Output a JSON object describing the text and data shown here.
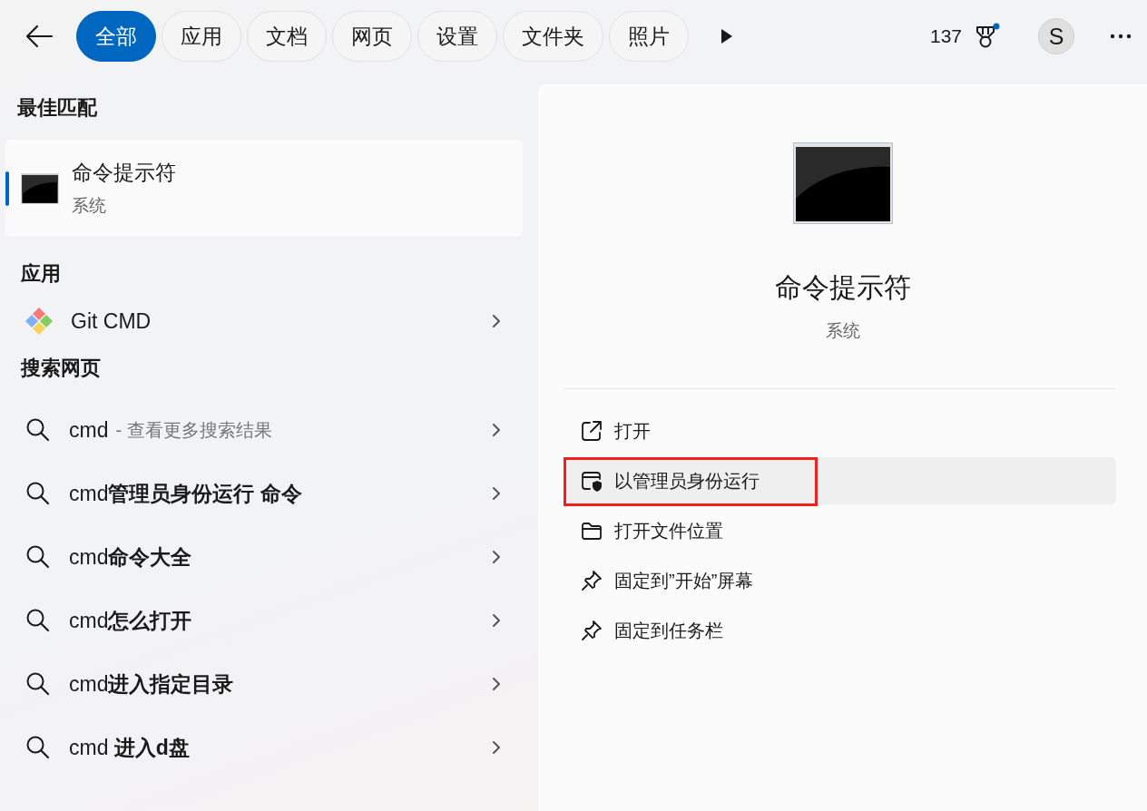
{
  "filter_tabs": [
    {
      "label": "全部",
      "selected": true
    },
    {
      "label": "应用",
      "selected": false
    },
    {
      "label": "文档",
      "selected": false
    },
    {
      "label": "网页",
      "selected": false
    },
    {
      "label": "设置",
      "selected": false
    },
    {
      "label": "文件夹",
      "selected": false
    },
    {
      "label": "照片",
      "selected": false
    }
  ],
  "points": "137",
  "rewards": {
    "unread": true
  },
  "avatar": {
    "initial": "S"
  },
  "best_match": {
    "title": "最佳匹配",
    "item": {
      "name": "命令提示符",
      "type": "系统",
      "selected": true
    }
  },
  "apps": {
    "title": "应用",
    "items": [
      {
        "name": "Git CMD"
      }
    ]
  },
  "web_search": {
    "title": "搜索网页",
    "items": [
      {
        "query": "cmd",
        "hint": "- 查看更多搜索结果"
      },
      {
        "query": "cmd**管理员身份运行 命令**"
      },
      {
        "query": "cmd**命令大全**"
      },
      {
        "query": "cmd**怎么打开**"
      },
      {
        "query": "cmd**进入指定目录**"
      },
      {
        "query": "cmd **进入d盘**"
      }
    ]
  },
  "details": {
    "name": "命令提示符",
    "type": "系统",
    "actions": [
      {
        "kind": "open",
        "label": "打开",
        "hovered": false,
        "highlighted": false
      },
      {
        "kind": "admin",
        "label": "以管理员身份运行",
        "hovered": true,
        "highlighted": true
      },
      {
        "kind": "folder",
        "label": "打开文件位置",
        "hovered": false,
        "highlighted": false
      },
      {
        "kind": "pin",
        "label": "固定到”开始”屏幕",
        "hovered": false,
        "highlighted": false
      },
      {
        "kind": "pin",
        "label": "固定到任务栏",
        "hovered": false,
        "highlighted": false
      }
    ]
  }
}
